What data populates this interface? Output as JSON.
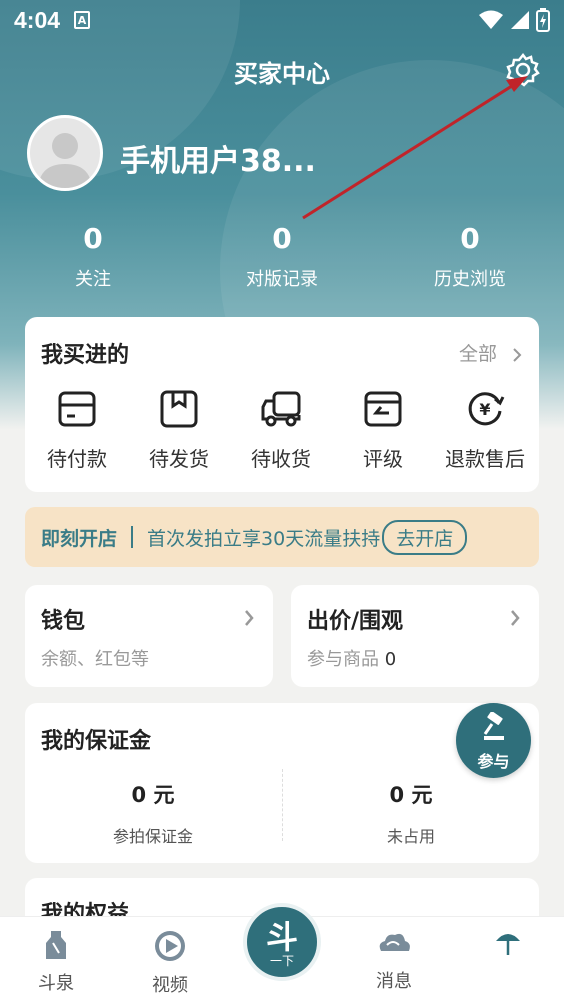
{
  "status_bar": {
    "time": "4:04",
    "notification_icon": "A"
  },
  "header": {
    "title": "买家中心",
    "username": "手机用户38...",
    "stats": [
      {
        "value": "0",
        "label": "关注"
      },
      {
        "value": "0",
        "label": "对版记录"
      },
      {
        "value": "0",
        "label": "历史浏览"
      }
    ]
  },
  "orders": {
    "title": "我买进的",
    "all_label": "全部",
    "items": [
      {
        "label": "待付款",
        "icon": "wallet-icon"
      },
      {
        "label": "待发货",
        "icon": "package-icon"
      },
      {
        "label": "待收货",
        "icon": "truck-icon"
      },
      {
        "label": "评级",
        "icon": "rating-icon"
      },
      {
        "label": "退款售后",
        "icon": "refund-icon"
      }
    ]
  },
  "banner": {
    "title": "即刻开店",
    "text": "首次发拍立享30天流量扶持",
    "button": "去开店"
  },
  "wallet": {
    "title": "钱包",
    "sub": "余额、红包等"
  },
  "bids": {
    "title": "出价/围观",
    "sub_label": "参与商品",
    "sub_value": "0"
  },
  "deposit": {
    "title": "我的保证金",
    "cols": [
      {
        "value": "0 元",
        "label": "参拍保证金"
      },
      {
        "value": "0 元",
        "label": "未占用"
      }
    ]
  },
  "fab": {
    "label": "参与"
  },
  "rights": {
    "title": "我的权益"
  },
  "tabbar": {
    "tabs": [
      {
        "label": "斗泉",
        "icon": "bottle-icon"
      },
      {
        "label": "视频",
        "icon": "play-icon"
      },
      {
        "label": "消息",
        "icon": "cloud-icon"
      },
      {
        "label": "",
        "icon": "umbrella-icon"
      }
    ],
    "center_top": "斗",
    "center_bottom": "一下"
  },
  "colors": {
    "accent": "#2f6f7b",
    "header": "#3b7d8c",
    "banner_bg": "#f7e3c6"
  }
}
